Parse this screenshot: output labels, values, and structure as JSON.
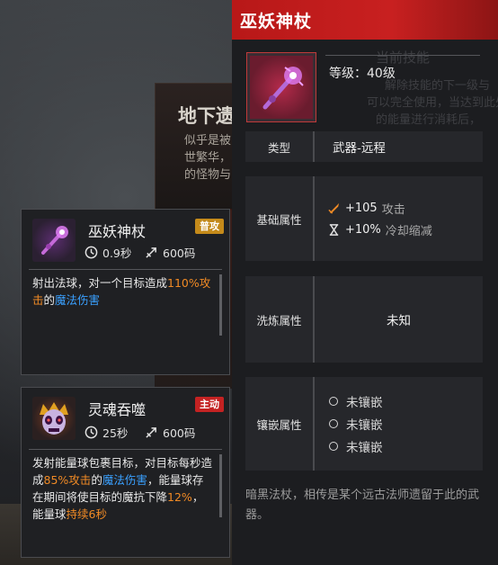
{
  "background": {
    "title": "地下遗",
    "text_lines": [
      "似乎是被",
      "世繁华，",
      "的怪物与"
    ]
  },
  "skills": [
    {
      "name": "巫妖神杖",
      "tag": "普攻",
      "cooldown": "0.9秒",
      "range": "600码",
      "desc_parts": [
        "射出法球，对一个目标造成",
        "110%攻击",
        "的",
        "魔法伤害"
      ]
    },
    {
      "name": "灵魂吞噬",
      "tag": "主动",
      "cooldown": "25秒",
      "range": "600码",
      "desc_parts": [
        "发射能量球包裹目标，对目标每秒造成",
        "85%攻击",
        "的",
        "魔法伤害",
        "，能量球存在期间将使目标的魔抗下降",
        "12%",
        "，能量球",
        "持续6秒"
      ]
    }
  ],
  "item": {
    "title": "巫妖神杖",
    "level": "等级：40级",
    "ghost_lines": [
      "当前技能",
      "解除技能的下一级与",
      "可以完全使用，当达到此处",
      "的能量进行消耗后，"
    ],
    "type_label": "类型",
    "type_value": "武器-远程",
    "base_label": "基础属性",
    "attrs": [
      {
        "value": "+105",
        "name": "攻击",
        "icon": "sword-icon"
      },
      {
        "value": "+10%",
        "name": "冷却缩减",
        "icon": "hourglass-icon"
      }
    ],
    "refine_label": "洗炼属性",
    "refine_value": "未知",
    "socket_label": "镶嵌属性",
    "sockets": [
      "未镶嵌",
      "未镶嵌",
      "未镶嵌"
    ],
    "flavor": "暗黑法杖，相传是某个远古法师遗留于此的武器。"
  },
  "colors": {
    "header_red": "#c42020",
    "highlight_orange": "#f08a25",
    "highlight_blue": "#3aa0ff",
    "tag_gold": "#c48a1a",
    "tag_red": "#c42222"
  }
}
